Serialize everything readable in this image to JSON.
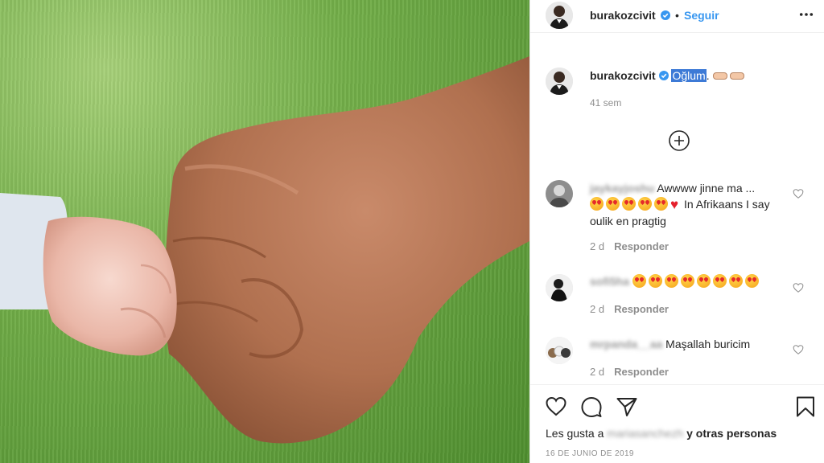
{
  "post": {
    "author": "burakozcivit",
    "follow_dot": "•",
    "follow_label": "Seguir",
    "more_icon": "more-icon"
  },
  "caption": {
    "author": "burakozcivit",
    "text_highlighted": "Oğlum",
    "text_rest": ".",
    "time": "41 sem"
  },
  "load_more_icon": "plus-circle-icon",
  "comments": [
    {
      "user": "jaykayjoshu",
      "text_first": "Awwww jinne ma ...",
      "text_second": "In Afrikaans I say oulik en pragtig",
      "time": "2 d",
      "reply": "Responder"
    },
    {
      "user": "sofi5ha",
      "text_first": "",
      "time": "2 d",
      "reply": "Responder"
    },
    {
      "user": "mrpanda__aa",
      "text_first": "Maşallah buricim",
      "time": "2 d",
      "reply": "Responder"
    }
  ],
  "actions": {
    "like_icon": "heart-icon",
    "comment_icon": "comment-icon",
    "share_icon": "share-icon",
    "save_icon": "bookmark-icon"
  },
  "likes": {
    "prefix": "Les gusta a",
    "user": "mariasanchezh",
    "suffix": "y otras personas"
  },
  "date": "16 DE JUNIO DE 2019",
  "colors": {
    "link": "#3897f0",
    "muted": "#8e8e8e",
    "text": "#262626"
  }
}
